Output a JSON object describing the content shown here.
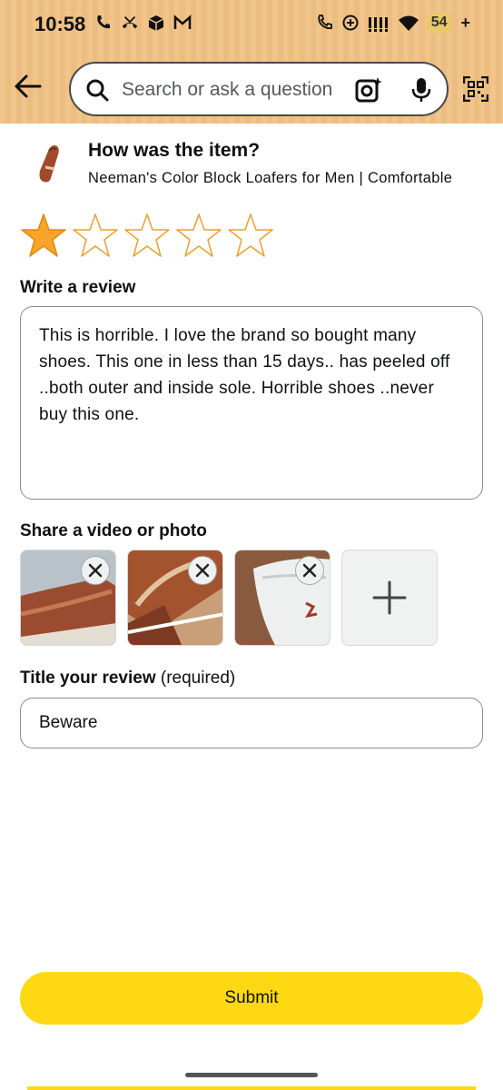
{
  "status_bar": {
    "time": "10:58",
    "left_icons": [
      "phone-wifi-icon",
      "missed-call-icon",
      "box-icon",
      "gmail-icon"
    ],
    "right_icons": [
      "call-icon",
      "data-saver-icon",
      "signal-icon",
      "wifi-icon"
    ],
    "battery": "54",
    "charging_symbol": "+"
  },
  "header": {
    "search_placeholder": "Search or ask a question",
    "icons": [
      "back-arrow-icon",
      "search-icon",
      "camera-lens-icon",
      "mic-icon",
      "qr-scan-icon"
    ]
  },
  "product": {
    "question": "How was the item?",
    "name": "Neeman's Color Block Loafers for Men | Comfortable"
  },
  "rating": {
    "value": 1,
    "max": 5,
    "color": "#f7a52a"
  },
  "review": {
    "label": "Write a review",
    "text": "This is horrible. I love the brand so bought many shoes. This one in less than 15 days.. has peeled off ..both outer and inside sole. Horrible shoes ..never buy this one."
  },
  "media": {
    "label": "Share a video or photo",
    "photos": [
      "photo-1",
      "photo-2",
      "photo-3"
    ],
    "add_symbol": "+"
  },
  "title": {
    "label": "Title your review",
    "required_note": "(required)",
    "value": "Beware"
  },
  "submit": {
    "label": "Submit",
    "color": "#ffd814"
  }
}
